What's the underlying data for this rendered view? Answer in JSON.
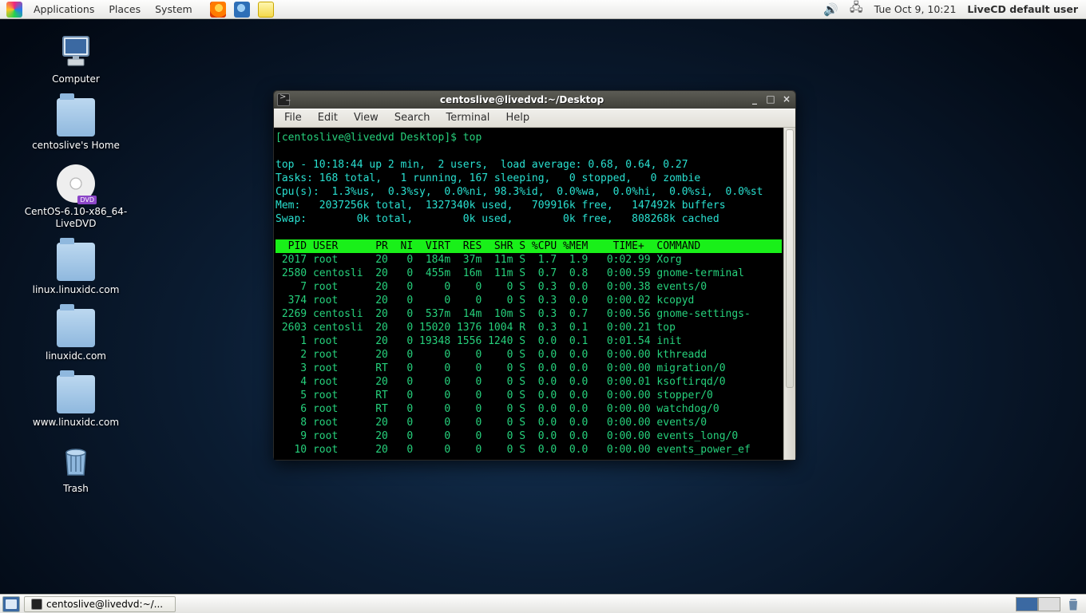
{
  "panel": {
    "menus": [
      "Applications",
      "Places",
      "System"
    ],
    "clock": "Tue Oct  9, 10:21",
    "user": "LiveCD default user"
  },
  "desktop_icons": [
    {
      "type": "computer",
      "label": "Computer"
    },
    {
      "type": "folder",
      "label": "centoslive's Home"
    },
    {
      "type": "disc",
      "label": "CentOS-6.10-x86_64-LiveDVD"
    },
    {
      "type": "folder",
      "label": "linux.linuxidc.com"
    },
    {
      "type": "folder",
      "label": "linuxidc.com"
    },
    {
      "type": "folder",
      "label": "www.linuxidc.com"
    },
    {
      "type": "trash",
      "label": "Trash"
    }
  ],
  "terminal": {
    "title": "centoslive@livedvd:~/Desktop",
    "menus": [
      "File",
      "Edit",
      "View",
      "Search",
      "Terminal",
      "Help"
    ],
    "prompt": "[centoslive@livedvd Desktop]$ ",
    "command": "top",
    "summary": [
      "top - 10:18:44 up 2 min,  2 users,  load average: 0.68, 0.64, 0.27",
      "Tasks: 168 total,   1 running, 167 sleeping,   0 stopped,   0 zombie",
      "Cpu(s):  1.3%us,  0.3%sy,  0.0%ni, 98.3%id,  0.0%wa,  0.0%hi,  0.0%si,  0.0%st",
      "Mem:   2037256k total,  1327340k used,   709916k free,   147492k buffers",
      "Swap:        0k total,        0k used,        0k free,   808268k cached"
    ],
    "header": "  PID USER      PR  NI  VIRT  RES  SHR S %CPU %MEM    TIME+  COMMAND           ",
    "rows": [
      " 2017 root      20   0  184m  37m  11m S  1.7  1.9   0:02.99 Xorg",
      " 2580 centosli  20   0  455m  16m  11m S  0.7  0.8   0:00.59 gnome-terminal",
      "    7 root      20   0     0    0    0 S  0.3  0.0   0:00.38 events/0",
      "  374 root      20   0     0    0    0 S  0.3  0.0   0:00.02 kcopyd",
      " 2269 centosli  20   0  537m  14m  10m S  0.3  0.7   0:00.56 gnome-settings-",
      " 2603 centosli  20   0 15020 1376 1004 R  0.3  0.1   0:00.21 top",
      "    1 root      20   0 19348 1556 1240 S  0.0  0.1   0:01.54 init",
      "    2 root      20   0     0    0    0 S  0.0  0.0   0:00.00 kthreadd",
      "    3 root      RT   0     0    0    0 S  0.0  0.0   0:00.00 migration/0",
      "    4 root      20   0     0    0    0 S  0.0  0.0   0:00.01 ksoftirqd/0",
      "    5 root      RT   0     0    0    0 S  0.0  0.0   0:00.00 stopper/0",
      "    6 root      RT   0     0    0    0 S  0.0  0.0   0:00.00 watchdog/0",
      "    8 root      20   0     0    0    0 S  0.0  0.0   0:00.00 events/0",
      "    9 root      20   0     0    0    0 S  0.0  0.0   0:00.00 events_long/0",
      "   10 root      20   0     0    0    0 S  0.0  0.0   0:00.00 events_power_ef"
    ]
  },
  "taskbar": {
    "task": "centoslive@livedvd:~/..."
  }
}
